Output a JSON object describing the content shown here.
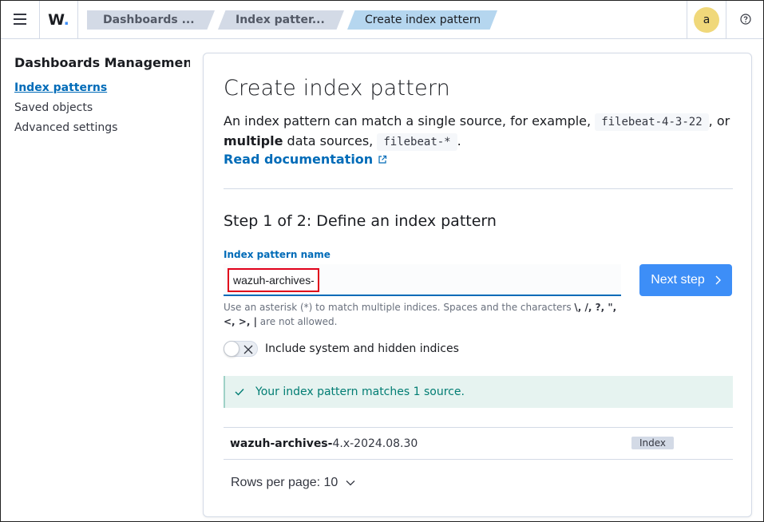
{
  "header": {
    "menu_icon": "hamburger-icon",
    "logo": "W.",
    "breadcrumbs": [
      {
        "label": "Dashboards ..."
      },
      {
        "label": "Index patter..."
      },
      {
        "label": "Create index pattern"
      }
    ],
    "avatar_letter": "a",
    "help_icon": "help-circle-icon"
  },
  "sidebar": {
    "title": "Dashboards Management",
    "items": [
      {
        "label": "Index patterns",
        "active": true
      },
      {
        "label": "Saved objects",
        "active": false
      },
      {
        "label": "Advanced settings",
        "active": false
      }
    ]
  },
  "main": {
    "title": "Create index pattern",
    "desc_part1": "An index pattern can match a single source, for example, ",
    "desc_code1": "filebeat-4-3-22",
    "desc_part2": ", or ",
    "desc_bold": "multiple",
    "desc_part3": " data sources, ",
    "desc_code2": "filebeat-*",
    "desc_part4": ".",
    "read_doc": "Read documentation",
    "step_title": "Step 1 of 2: Define an index pattern",
    "field_label": "Index pattern name",
    "field_value": "wazuh-archives-*",
    "help_part1": "Use an asterisk (*) to match multiple indices. Spaces and the characters ",
    "help_chars": "\\, /, ?, \",",
    "help_chars2": "<, >, |",
    "help_part2": " are not allowed.",
    "next_label": "Next step",
    "toggle_label": "Include system and hidden indices",
    "toggle_on": false,
    "callout": "Your index pattern matches 1 source.",
    "rows": [
      {
        "name_bold": "wazuh-archives-",
        "name_rest": "4.x-2024.08.30",
        "badge": "Index"
      }
    ],
    "rows_per_page": "Rows per page: 10"
  },
  "colors": {
    "accent": "#006bb8",
    "button": "#3d8ef7",
    "success_bg": "#e6f3f0",
    "success_text": "#017d73",
    "highlight": "#e0001a"
  }
}
